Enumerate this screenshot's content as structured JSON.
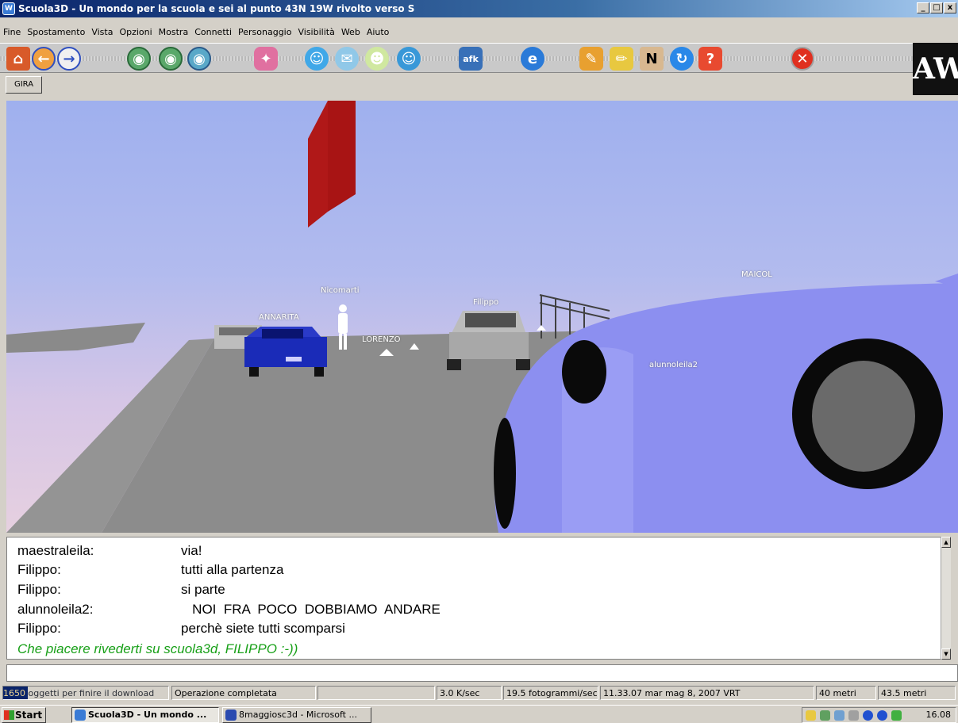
{
  "window": {
    "title": "Scuola3D - Un mondo per la scuola e sei al punto 43N 19W rivolto verso S",
    "min_label": "_",
    "max_label": "□",
    "close_label": "x"
  },
  "menu": [
    "Fine",
    "Spostamento",
    "Vista",
    "Opzioni",
    "Mostra",
    "Connetti",
    "Personaggio",
    "Visibilità",
    "Web",
    "Aiuto"
  ],
  "toolbar": {
    "gira_label": "GIRA",
    "logo_text": "AW"
  },
  "world": {
    "avatars": [
      "Nicomarti",
      "ANNARITA",
      "LORENZO",
      "Filippo",
      "MAICOL",
      "alunnoleila2"
    ],
    "colors": {
      "car_blue": "#1a2bb8",
      "car_white": "#c8c8c8",
      "car_lilac": "#8c8ff0",
      "ground": "#8a8a8a",
      "sign_red": "#b01818"
    }
  },
  "chat": {
    "lines": [
      {
        "name": "maestraleila:",
        "msg": "via!"
      },
      {
        "name": "Filippo:",
        "msg": "tutti alla partenza"
      },
      {
        "name": "Filippo:",
        "msg": "si parte"
      },
      {
        "name": "alunnoleila2:",
        "msg": "   NOI  FRA  POCO  DOBBIAMO  ANDARE"
      },
      {
        "name": "Filippo:",
        "msg": "perchè siete tutti scomparsi"
      }
    ],
    "system_message": "Che piacere rivederti su scuola3d, FILIPPO :-))",
    "system_color": "#18a018"
  },
  "status": {
    "download": "1650 oggetti per finire il download",
    "download_progress": 0.15,
    "operation": "Operazione completata",
    "empty": "",
    "speed": "3.0 K/sec",
    "fps": "19.5 fotogrammi/sec",
    "datetime": "11.33.07 mar mag 8, 2007 VRT",
    "distance1": "40 metri",
    "distance2": "43.5 metri"
  },
  "taskbar": {
    "start_label": "Start",
    "tasks": [
      "Scuola3D - Un mondo ...",
      "8maggiosc3d - Microsoft ..."
    ],
    "clock": "16.08"
  }
}
